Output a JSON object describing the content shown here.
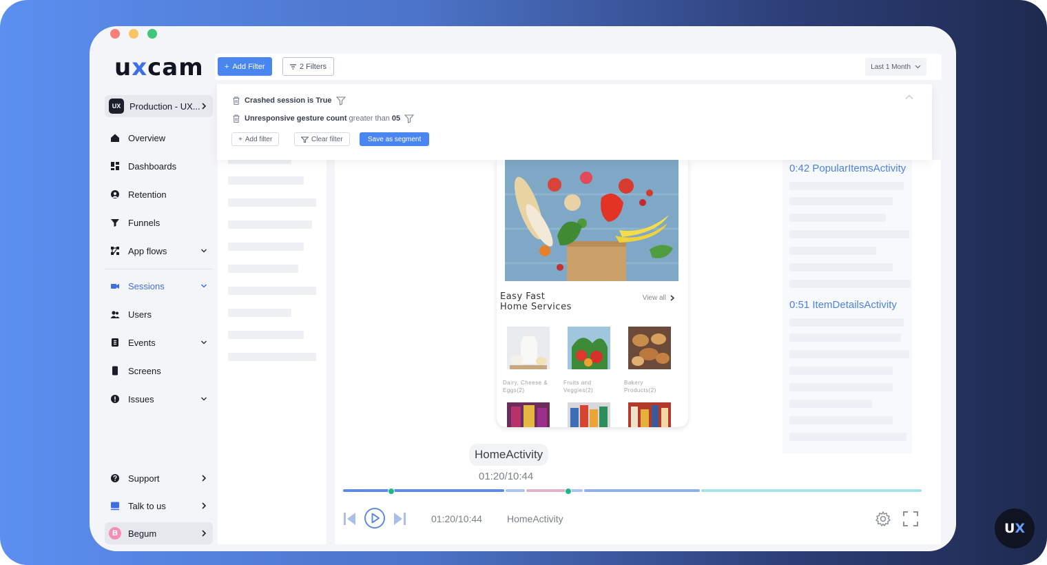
{
  "window": {
    "traffic_lights": [
      "close",
      "minimize",
      "maximize"
    ]
  },
  "brand": {
    "logo_prefix": "u",
    "logo_x": "x",
    "logo_suffix": "cam",
    "accent": "#3e6fe8"
  },
  "project": {
    "badge": "UX",
    "label": "Production - UX..."
  },
  "nav": {
    "overview": "Overview",
    "dashboards": "Dashboards",
    "retention": "Retention",
    "funnels": "Funnels",
    "app_flows": "App flows",
    "sessions": "Sessions",
    "users": "Users",
    "events": "Events",
    "screens": "Screens",
    "issues": "Issues",
    "support": "Support",
    "talk_to_us": "Talk to us",
    "user_initial": "B",
    "user_name": "Begum"
  },
  "topbar": {
    "add_filter": "Add Filter",
    "filters": "2 Filters",
    "period": "Last 1 Month"
  },
  "filters": {
    "cond1": {
      "text": "Crashed session is True"
    },
    "cond2": {
      "prefix": "Unresponsive gesture count",
      "op": "greater than",
      "value": "05"
    },
    "add_filter": "Add filter",
    "clear_filter": "Clear filter",
    "save_segment": "Save as segment"
  },
  "player": {
    "app_title_line1": "Easy Fast",
    "app_title_line2": "Home Services",
    "view_all": "View all",
    "categories": [
      {
        "line1": "Dairy, Cheese &",
        "line2": "Eggs(2)"
      },
      {
        "line1": "Fruits and",
        "line2": "Veggies(2)"
      },
      {
        "line1": "Bakery",
        "line2": "Products(2)"
      }
    ],
    "screen_label": "HomeActivity",
    "time_top": "01:20/10:44",
    "time_control": "01:20/10:44",
    "screen_control": "HomeActivity",
    "progress_fraction": 0.124
  },
  "activity": {
    "item1": "0:42 PopularItemsActivity",
    "item2": "0:51 ItemDetailsActivity"
  },
  "corner_badge": {
    "left": "U",
    "right": "X"
  }
}
